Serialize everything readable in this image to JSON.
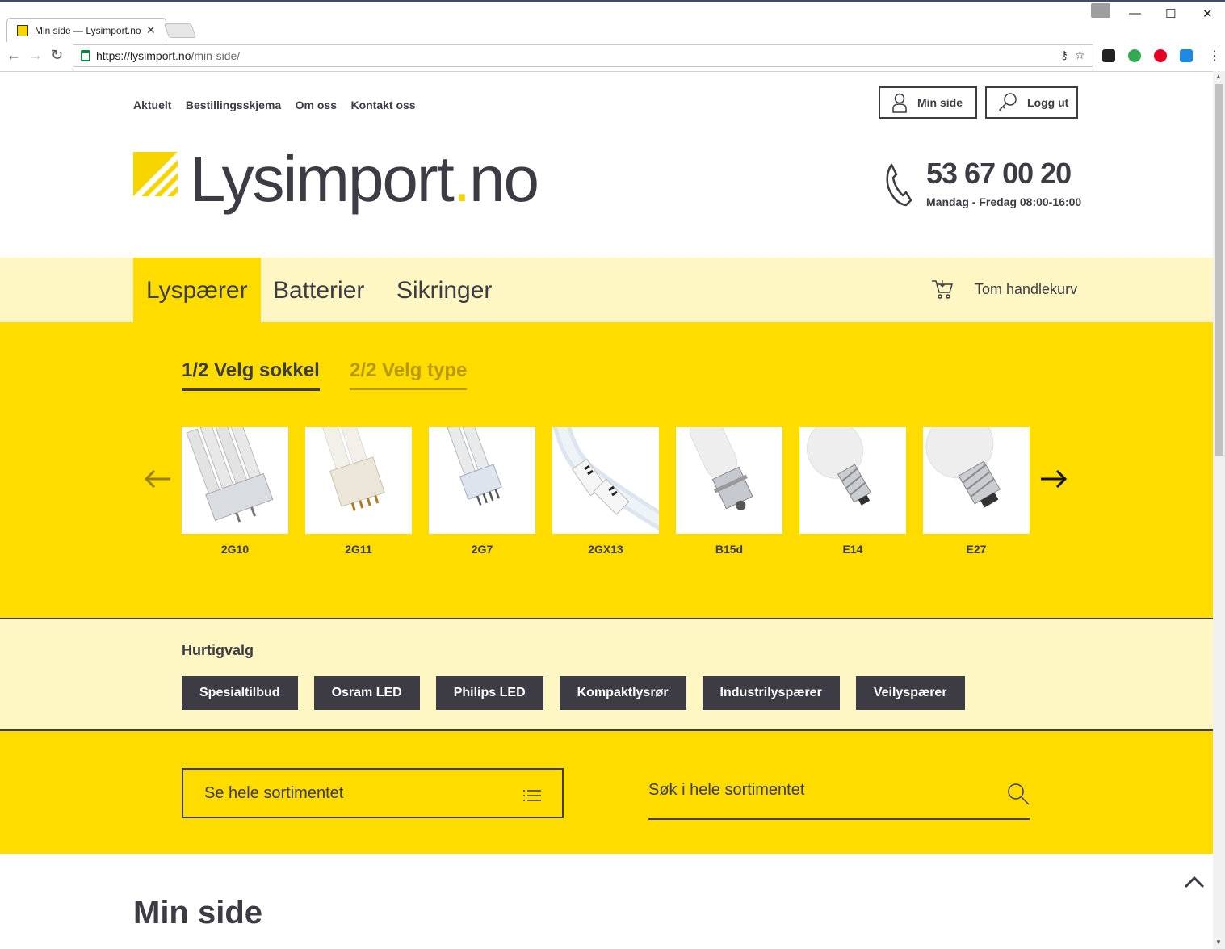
{
  "browser": {
    "tab_title": "Min side — Lysimport.no",
    "url_host": "https://lysimport.no",
    "url_path": "/min-side/"
  },
  "topnav": [
    {
      "label": "Aktuelt"
    },
    {
      "label": "Bestillingsskjema"
    },
    {
      "label": "Om oss"
    },
    {
      "label": "Kontakt oss"
    }
  ],
  "account": {
    "my_page_label": "Min side",
    "logout_label": "Logg ut"
  },
  "logo": {
    "name": "Lysimport",
    "dot": ".",
    "tld": "no"
  },
  "contact": {
    "phone": "53 67 00 20",
    "hours": "Mandag - Fredag 08:00-16:00"
  },
  "categories": [
    {
      "label": "Lyspærer",
      "active": true
    },
    {
      "label": "Batterier",
      "active": false
    },
    {
      "label": "Sikringer",
      "active": false
    }
  ],
  "cart": {
    "label": "Tom handlekurv"
  },
  "selector": {
    "step1": "1/2 Velg sokkel",
    "step2": "2/2 Velg type",
    "sockets": [
      {
        "label": "2G10"
      },
      {
        "label": "2G11"
      },
      {
        "label": "2G7"
      },
      {
        "label": "2GX13"
      },
      {
        "label": "B15d"
      },
      {
        "label": "E14"
      },
      {
        "label": "E27"
      }
    ]
  },
  "quick": {
    "title": "Hurtigvalg",
    "buttons": [
      {
        "label": "Spesialtilbud"
      },
      {
        "label": "Osram LED"
      },
      {
        "label": "Philips LED"
      },
      {
        "label": "Kompaktlysrør"
      },
      {
        "label": "Industrilyspærer"
      },
      {
        "label": "Veilyspærer"
      }
    ]
  },
  "search": {
    "browse_all": "Se hele sortimentet",
    "placeholder": "Søk i hele sortimentet"
  },
  "page_heading": "Min side",
  "colors": {
    "brand_yellow": "#fedc00",
    "light_yellow": "#fff7c3",
    "dark": "#3d3b44"
  }
}
